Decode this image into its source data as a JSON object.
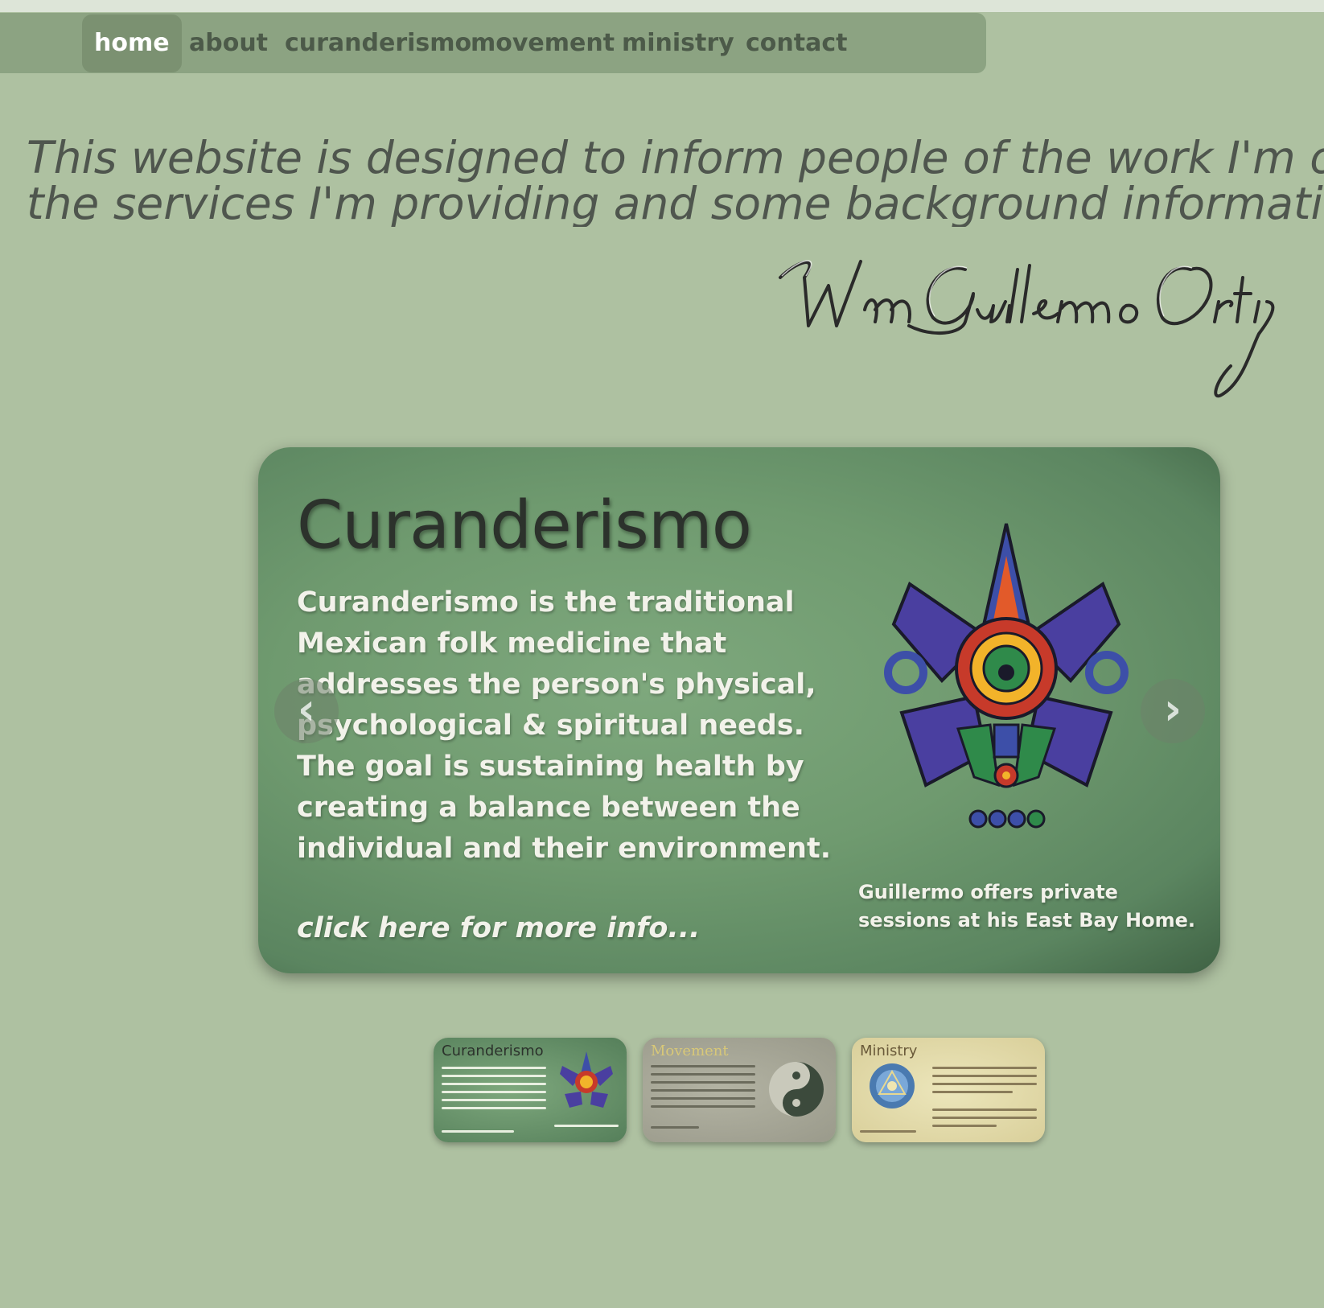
{
  "nav": {
    "items": [
      {
        "label": "home",
        "active": true
      },
      {
        "label": "about",
        "active": false
      },
      {
        "label": "curanderismo",
        "active": false
      },
      {
        "label": "movement",
        "active": false
      },
      {
        "label": "ministry",
        "active": false
      },
      {
        "label": "contact",
        "active": false
      }
    ]
  },
  "intro": {
    "line1": "This website is designed to inform people of the work I'm offering,",
    "line2": "the services I'm providing and some background information."
  },
  "signature": {
    "text": "Wm Guillermo Ortiz"
  },
  "slider": {
    "title": "Curanderismo",
    "body": "Curanderismo is the traditional Mexican folk medicine that addresses the person's physical, psychological & spiritual needs. The goal is sustaining health by creating a balance between the individual and their environment.",
    "more_link": "click here for more info...",
    "note": "Guillermo offers private sessions at his East Bay Home.",
    "prev_label": "‹",
    "next_label": "›"
  },
  "thumbnails": [
    {
      "title": "Curanderismo",
      "title_color": "#2c322c"
    },
    {
      "title": "Movement",
      "title_color": "#d8c878"
    },
    {
      "title": "Ministry",
      "title_color": "#6a5a3a"
    }
  ],
  "colors": {
    "background": "#aec1a1",
    "nav_bar": "#8ca382",
    "nav_active": "#7b9171",
    "nav_text": "#4c5a49",
    "intro_text": "#4f564e"
  }
}
